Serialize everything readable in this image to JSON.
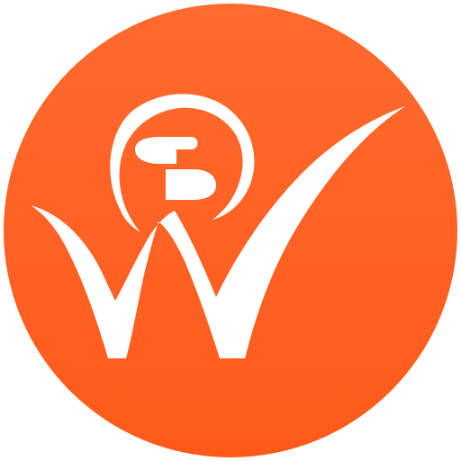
{
  "logo": {
    "icon": "w-checkmark-dollar-logo-icon",
    "circle_color_top": "#ff6a2e",
    "circle_color_bottom": "#ff5a1a",
    "mark_color": "#ffffff"
  }
}
